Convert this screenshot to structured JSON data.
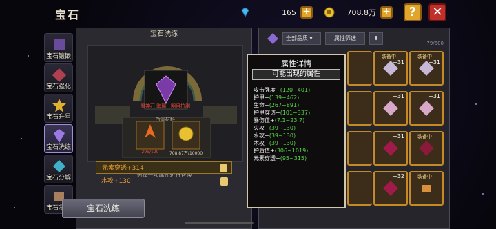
{
  "header": {
    "title": "宝石",
    "diamond_value": "165",
    "gold_value": "708.8万",
    "help_label": "?",
    "close_label": "✕"
  },
  "tabs": [
    {
      "label": "宝石镶嵌"
    },
    {
      "label": "宝石强化"
    },
    {
      "label": "宝石升星"
    },
    {
      "label": "宝石洗练"
    },
    {
      "label": "宝石分解"
    },
    {
      "label": "宝石凝结"
    }
  ],
  "wash_panel": {
    "title": "宝石洗练",
    "gem_name": "魔神石·晦瑶 · 明月拉刷",
    "materials_label": "所需材料",
    "material1_count": "295/120",
    "material2_count": "708.87万/10000",
    "select_hint": "选择一项属性进行替换",
    "options": [
      {
        "label": "元素穿透+314"
      },
      {
        "label": "水攻+130"
      }
    ],
    "wash_button": "宝石洗练"
  },
  "inventory": {
    "filter_quality": "全部品质",
    "filter_attr": "属性筛选",
    "count": "79/500",
    "level_tag": "+31",
    "level_tag2": "+32",
    "equipped_tag": "装备中"
  },
  "tooltip": {
    "title": "属性详情",
    "subtitle": "可能出现的属性",
    "attributes": [
      {
        "name": "攻击强度+",
        "range": "(120~401)"
      },
      {
        "name": "护甲+",
        "range": "(139~462)"
      },
      {
        "name": "生命+",
        "range": "(267~891)"
      },
      {
        "name": "护甲穿透+",
        "range": "(101~337)"
      },
      {
        "name": "暴伤值+",
        "range": "(7.1~23.7)"
      },
      {
        "name": "火攻+",
        "range": "(39~130)"
      },
      {
        "name": "水攻+",
        "range": "(39~130)"
      },
      {
        "name": "木攻+",
        "range": "(39~130)"
      },
      {
        "name": "护盾值+",
        "range": "(306~1019)"
      },
      {
        "name": "元素穿透+",
        "range": "(95~315)"
      }
    ]
  },
  "colors": {
    "accent_gold": "#e0a52a",
    "close_red": "#c0302a",
    "range_green": "#59d64c",
    "option_orange": "#f0a030"
  }
}
